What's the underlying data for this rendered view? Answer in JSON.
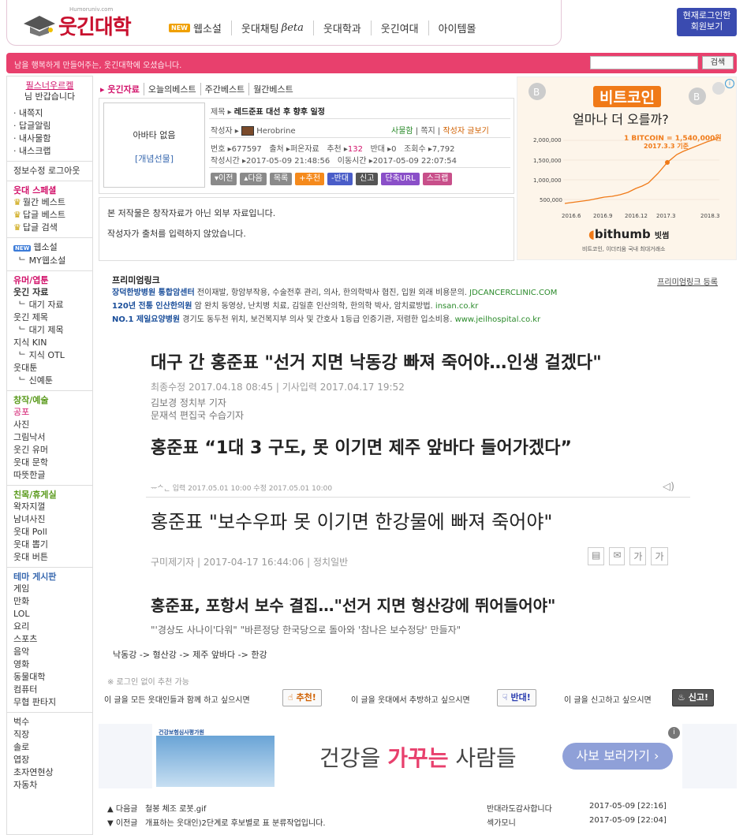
{
  "header": {
    "logo_text": "웃긴대학",
    "logo_sub": "Humoruniv.com",
    "nav": [
      {
        "badge": "NEW",
        "label": "웹소설"
      },
      {
        "label": "웃대채팅",
        "beta": "βeta"
      },
      {
        "label": "웃대학과"
      },
      {
        "label": "웃긴여대"
      },
      {
        "label": "아이템몰"
      }
    ],
    "login_line1": "현재로그인한",
    "login_line2": "회원보기"
  },
  "pinkbar": {
    "message": "남을 행복하게 만들어주는, 웃긴대학에 오셨습니다.",
    "search_button": "검색"
  },
  "sidebar": {
    "user_name": "필스너우르켈",
    "greeting": "님 반갑습니다",
    "my_items": [
      "· 내쪽지",
      "· 답글알림",
      "· 내사물함",
      "· 내스크랩"
    ],
    "account": "정보수정 로그아웃",
    "special_title": "웃대 스페셜",
    "special_items": [
      "월간 베스트",
      "답글 베스트",
      "답글 검색"
    ],
    "webnovel_badge": "NEW",
    "webnovel": "웹소설",
    "my_webnovel": "ᄂ MY웹소설",
    "humor_title": "유머/엽툰",
    "humor_items": [
      {
        "label": "웃긴 자료",
        "bold": true
      },
      {
        "label": "ᄂ 대기 자료",
        "sub": true
      },
      {
        "label": "웃긴 제목"
      },
      {
        "label": "ᄂ 대기 제목",
        "sub": true
      },
      {
        "label": "지식 KIN"
      },
      {
        "label": "ᄂ 지식 OTL",
        "sub": true
      },
      {
        "label": "웃대툰"
      },
      {
        "label": "ᄂ 신예툰",
        "sub": true
      }
    ],
    "art_title": "창작/예술",
    "art_items": [
      {
        "label": "공포",
        "red": true
      },
      {
        "label": "사진"
      },
      {
        "label": "그림낙서"
      },
      {
        "label": "웃긴 유머"
      },
      {
        "label": "웃대 문학"
      },
      {
        "label": "따뜻한글"
      }
    ],
    "social_title": "친목/휴게실",
    "social_items": [
      "왁자지껄",
      "남녀사진",
      "웃대 Poll",
      "웃대 뽑기",
      "웃대 버튼"
    ],
    "theme_title": "테마 게시판",
    "theme_items": [
      "게임",
      "만화",
      "LOL",
      "요리",
      "스포츠",
      "음악",
      "영화",
      "동물대학",
      "컴퓨터",
      "무협 판타지"
    ],
    "etc_items": [
      "벅수",
      "직장",
      "솔로",
      "엽장",
      "초자연현상",
      "자동차"
    ]
  },
  "boardnav": [
    "▸ 웃긴자료",
    "오늘의베스트",
    "주간베스트",
    "월간베스트"
  ],
  "post": {
    "no_avatar": "아바타 없음",
    "gift": "[개념선물]",
    "title_label": "제목 ▸",
    "title": "레드준표 대선 후 향후 일정",
    "author_label": "작성자 ▸",
    "author": "Herobrine",
    "author_links": [
      "사물함",
      "쪽지",
      "작성자 글보기"
    ],
    "number_label": "번호 ▸",
    "number": "677597",
    "source_label": "출처 ▸",
    "source": "퍼온자료",
    "rec_label": "추천 ▸",
    "rec": "132",
    "opp_label": "반대 ▸",
    "opp": "0",
    "views_label": "조회수 ▸",
    "views": "7,792",
    "written_label": "작성시간 ▸",
    "written": "2017-05-09 21:48:56",
    "moved_label": "이동시간 ▸",
    "moved": "2017-05-09 22:07:54",
    "buttons": [
      "▾이전",
      "▴다음",
      "목록",
      "+추천",
      "-반대",
      "신고",
      "단축URL",
      "스크랩"
    ]
  },
  "source_notes": [
    "본 저작물은 창작자료가 아닌 외부 자료입니다.",
    "작성자가 출처를 입력하지 않았습니다."
  ],
  "ad1": {
    "title": "비트코인",
    "subtitle": "얼마나 더 오를까?",
    "price_note": "1 BITCOIN = 1,540,000원",
    "price_date": "2017.3.3 기준",
    "y_labels": [
      "2,000,000",
      "1,500,000",
      "1,000,000",
      "500,000"
    ],
    "x_labels": [
      "2016.6",
      "2016.9",
      "2016.12",
      "2017.3",
      "2018.3"
    ],
    "brand": "bithumb",
    "brand_kr": "빗썸",
    "brand_sub": "비트코인, 이더리움 국내 최대거래소",
    "color": "#f07a18"
  },
  "premium": {
    "title": "프리미엄링크",
    "register": "프리미엄링크 등록",
    "links": [
      {
        "name": "장덕한방병원 통합암센터",
        "desc": "전이재발, 항암부작용, 수술전후 관리, 의사, 한의학박사 협진, 입원 외래 비용문의.",
        "url": "JDCANCERCLINIC.COM"
      },
      {
        "name": "120년 전통 인산한의원",
        "desc": "암 완치 동영상, 난치병 치료, 김일훈 인산의학, 한의학 박사, 암치료방법.",
        "url": "insan.co.kr"
      },
      {
        "name": "NO.1 제일요양병원",
        "desc": "경기도 동두천 위치, 보건복지부 의사 및 간호사 1등급 인증기관, 저렴한 입소비용.",
        "url": "www.jeilhospital.co.kr"
      }
    ]
  },
  "article": {
    "h1": "대구 간 홍준표 \"선거 지면 낙동강 빠져 죽어야…인생 걸겠다\"",
    "m1": "최종수정 2017.04.18 08:45  |  기사입력 2017.04.17 19:52",
    "m2": "김보경 정치부 기자",
    "m3": "문재석 편집국 수습기자",
    "h2": "홍준표 “1대 3 구도, 못 이기면 제주 앞바다 들어가겠다”",
    "m4": "ᅲᄉᆫ   입력 2017.05.01 10:00   수정 2017.05.01 10:00",
    "h3": "홍준표 \"보수우파 못 이기면 한강물에 빠져 죽어야\"",
    "m5": "구미제기자  |  2017-04-17 16:44:06  |  정치일반",
    "h4": "홍준표, 포항서 보수 결집…\"선거 지면 형산강에 뛰어들어야\"",
    "m6": "\"'경상도 사나이'다워\"  \"바른정당 한국당으로 돌아와 '참나은 보수정당' 만들자\"",
    "chain": "낙동강 -> 형산강 -> 제주 앞바다 -> 한강"
  },
  "recommend": {
    "login_note": "※ 로그인 없이 추천 가능",
    "rec_text": "이 글을 모든 웃대인들과 함께 하고 싶으시면",
    "rec_btn": "추천!",
    "opp_text": "이 글을 웃대에서 추방하고 싶으시면",
    "opp_btn": "반대!",
    "rep_text": "이 글을 신고하고 싶으시면",
    "rep_btn": "신고!"
  },
  "ad2": {
    "org": "건강보험심사평가원",
    "slogan_a": "건강을",
    "slogan_b": "가꾸는",
    "slogan_c": "사람들",
    "cta": "사보 보러가기 ›"
  },
  "prevnext": [
    {
      "label": "▲ 다음글",
      "title": "철봉 체조 로봇.gif",
      "author": "반대라도감사합니다",
      "date": "2017-05-09 [22:16]"
    },
    {
      "label": "▼ 이전글",
      "title": "개표하는 웃대인)2단계로 후보별로 표 분류작업입니다.",
      "author": "섹가모니",
      "date": "2017-05-09 [22:04]"
    }
  ]
}
